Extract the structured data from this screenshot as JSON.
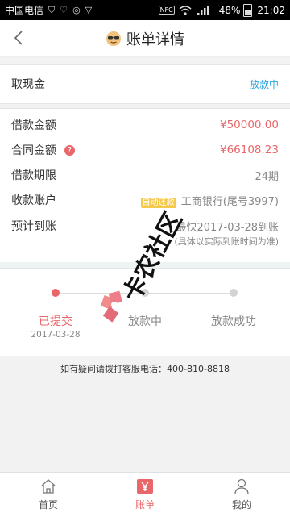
{
  "status_bar": {
    "carrier": "中国电信",
    "battery": "48%",
    "time": "21:02",
    "nfc": "NFC"
  },
  "header": {
    "title": "账单详情",
    "icons": {
      "back": "chevron-left-icon",
      "logo": "sunglasses-face-icon"
    }
  },
  "withdraw": {
    "label": "取现金",
    "status": "放款中"
  },
  "details": {
    "loan_amount_label": "借款金额",
    "loan_amount": "¥50000.00",
    "contract_amount_label": "合同金额",
    "contract_amount": "¥66108.23",
    "help_icon": "?",
    "term_label": "借款期限",
    "term": "24期",
    "account_label": "收款账户",
    "account_badge": "自动还款",
    "account": "工商银行(尾号3997)",
    "arrival_label": "预计到账",
    "arrival": "最快2017-03-28到账",
    "arrival_note": "(具体以实际到账时间为准)"
  },
  "progress": {
    "steps": [
      {
        "label": "已提交",
        "date": "2017-03-28",
        "active": true
      },
      {
        "label": "放款中",
        "date": "",
        "active": false
      },
      {
        "label": "放款成功",
        "date": "",
        "active": false
      }
    ]
  },
  "contact": "如有疑问请拨打客服电话：400-810-8818",
  "watermark": "卡农社区",
  "tabs": [
    {
      "label": "首页",
      "icon": "home-icon",
      "active": false
    },
    {
      "label": "账单",
      "icon": "yen-bill-icon",
      "active": true
    },
    {
      "label": "我的",
      "icon": "person-icon",
      "active": false
    }
  ],
  "colors": {
    "accent": "#e9676a",
    "status_blue": "#2aa6df",
    "badge": "#f6c84a"
  }
}
